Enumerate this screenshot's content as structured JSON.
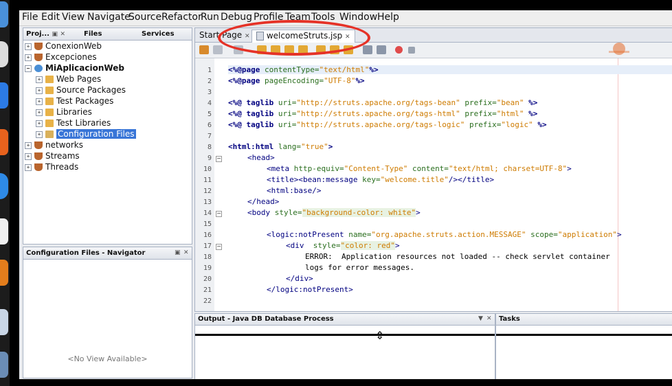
{
  "menu": [
    "File",
    "Edit",
    "View",
    "Navigate",
    "Source",
    "Refactor",
    "Run",
    "Debug",
    "Profile",
    "Team",
    "Tools",
    "Window",
    "Help"
  ],
  "left_tabs": {
    "projects": "Proj...",
    "files": "Files",
    "services": "Services"
  },
  "tree": [
    {
      "label": "ConexionWeb",
      "icon": "coffee-cup-icon"
    },
    {
      "label": "Excepciones",
      "icon": "coffee-cup-icon"
    },
    {
      "label": "MiAplicacionWeb",
      "icon": "globe-icon"
    },
    {
      "label": "Web Pages",
      "icon": "folder-icon"
    },
    {
      "label": "Source Packages",
      "icon": "folder-icon"
    },
    {
      "label": "Test Packages",
      "icon": "folder-icon"
    },
    {
      "label": "Libraries",
      "icon": "folder-icon"
    },
    {
      "label": "Test Libraries",
      "icon": "folder-icon"
    },
    {
      "label": "Configuration Files",
      "icon": "config-folder-icon"
    },
    {
      "label": "networks",
      "icon": "coffee-cup-icon"
    },
    {
      "label": "Streams",
      "icon": "coffee-cup-icon"
    },
    {
      "label": "Threads",
      "icon": "coffee-cup-icon"
    }
  ],
  "navigator": {
    "title": "Configuration Files - Navigator",
    "empty": "<No View Available>"
  },
  "editor_tabs": {
    "start": "Start Page",
    "active": "welcomeStruts.jsp"
  },
  "code_lines": {
    "n1": "1",
    "n2": "2",
    "n3": "3",
    "n4": "4",
    "n5": "5",
    "n6": "6",
    "n7": "7",
    "n8": "8",
    "n9": "9",
    "n10": "10",
    "n11": "11",
    "n12": "12",
    "n13": "13",
    "n14": "14",
    "n15": "15",
    "n16": "16",
    "n17": "17",
    "n18": "18",
    "n19": "19",
    "n20": "20",
    "n21": "21",
    "n22": "22"
  },
  "code": {
    "l1_a": "<%@page ",
    "l1_b": "contentType=",
    "l1_c": "\"text/html\"",
    "l1_d": "%>",
    "l2_a": "<%@page ",
    "l2_b": "pageEncoding=",
    "l2_c": "\"UTF-8\"",
    "l2_d": "%>",
    "l4_a": "<%@ taglib ",
    "l4_b": "uri=",
    "l4_c": "\"http://struts.apache.org/tags-bean\"",
    "l4_d": " prefix=",
    "l4_e": "\"bean\"",
    "l4_f": " %>",
    "l5_a": "<%@ taglib ",
    "l5_b": "uri=",
    "l5_c": "\"http://struts.apache.org/tags-html\"",
    "l5_d": " prefix=",
    "l5_e": "\"html\"",
    "l5_f": " %>",
    "l6_a": "<%@ taglib ",
    "l6_b": "uri=",
    "l6_c": "\"http://struts.apache.org/tags-logic\"",
    "l6_d": " prefix=",
    "l6_e": "\"logic\"",
    "l6_f": " %>",
    "l8_a": "<html:html ",
    "l8_b": "lang=",
    "l8_c": "\"true\"",
    "l8_d": ">",
    "l9": "<head>",
    "l10_a": "<meta ",
    "l10_b": "http-equiv=",
    "l10_c": "\"Content-Type\"",
    "l10_d": " content=",
    "l10_e": "\"text/html; charset=UTF-8\"",
    "l10_f": ">",
    "l11_a": "<title><bean:message ",
    "l11_b": "key=",
    "l11_c": "\"welcome.title\"",
    "l11_d": "/></title>",
    "l12": "<html:base/>",
    "l13": "</head>",
    "l14_a": "<body ",
    "l14_b": "style=",
    "l14_c": "\"background-color: white\"",
    "l14_d": ">",
    "l16_a": "<logic:notPresent ",
    "l16_b": "name=",
    "l16_c": "\"org.apache.struts.action.MESSAGE\"",
    "l16_d": " scope=",
    "l16_e": "\"application\"",
    "l16_f": ">",
    "l17_a": "<div  ",
    "l17_b": "style=",
    "l17_c": "\"color: red\"",
    "l17_d": ">",
    "l18": "ERROR:  Application resources not loaded -- check servlet container",
    "l19": "logs for error messages.",
    "l20": "</div>",
    "l21": "</logic:notPresent>"
  },
  "output_title": "Output - Java DB Database Process",
  "tasks_title": "Tasks",
  "colors": {
    "highlight_ring": "#e53227",
    "selection": "#3875d7",
    "tag": "#000080",
    "attribute": "#2a6e1e",
    "string": "#ce7b00"
  }
}
